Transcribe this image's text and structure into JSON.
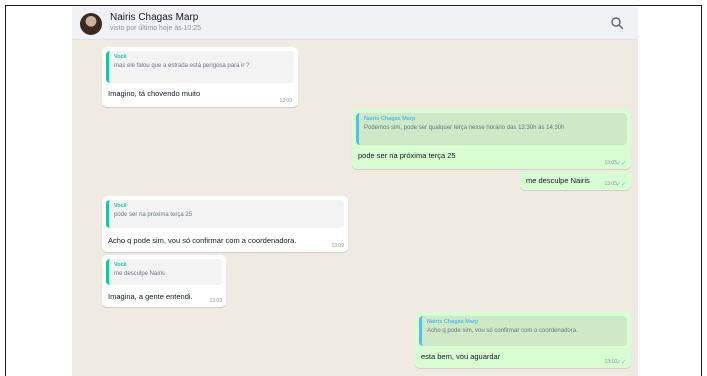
{
  "header": {
    "contact_name": "Nairis Chagas Marp",
    "last_seen": "visto por último hoje às 10:25",
    "search_icon": "search-icon"
  },
  "messages": [
    {
      "direction": "in",
      "quote_author": "Você",
      "quote_text": "mas ele falou que a estrada está perigosa para ir ?",
      "text": "Imagino, tá chovendo muito",
      "time": "13:00"
    },
    {
      "direction": "out",
      "quote_author": "Nairis Chagas Marp",
      "quote_text": "Podemos sim, pode ser qualquer terça nesse horário das 13:30h às 14:30h",
      "text": "pode ser na próxima terça 25",
      "time": "13:05"
    },
    {
      "direction": "out",
      "text": "me desculpe Nairis",
      "time": "13:05"
    },
    {
      "direction": "in",
      "quote_author": "Você",
      "quote_text": "pode ser na próxima terça 25",
      "text": "Acho q pode sim, vou só confirmar com a coordenadora.",
      "time": "13:09"
    },
    {
      "direction": "in",
      "quote_author": "Você",
      "quote_text": "me desculpe Nairis",
      "text": "Imagina, a gente entendi.",
      "time": "13:09"
    },
    {
      "direction": "out",
      "quote_author": "Nairis Chagas Marp",
      "quote_text": "Acho q pode sim, vou só confirmar com o coordenadora.",
      "text": "esta bem, vou aguardar",
      "time": "13:10"
    }
  ],
  "colors": {
    "chat_background": "#efeae2",
    "incoming_bubble": "#ffffff",
    "outgoing_bubble": "#d9fdd3",
    "incoming_quote_accent": "#06cf9c",
    "outgoing_quote_accent": "#53bdeb"
  }
}
